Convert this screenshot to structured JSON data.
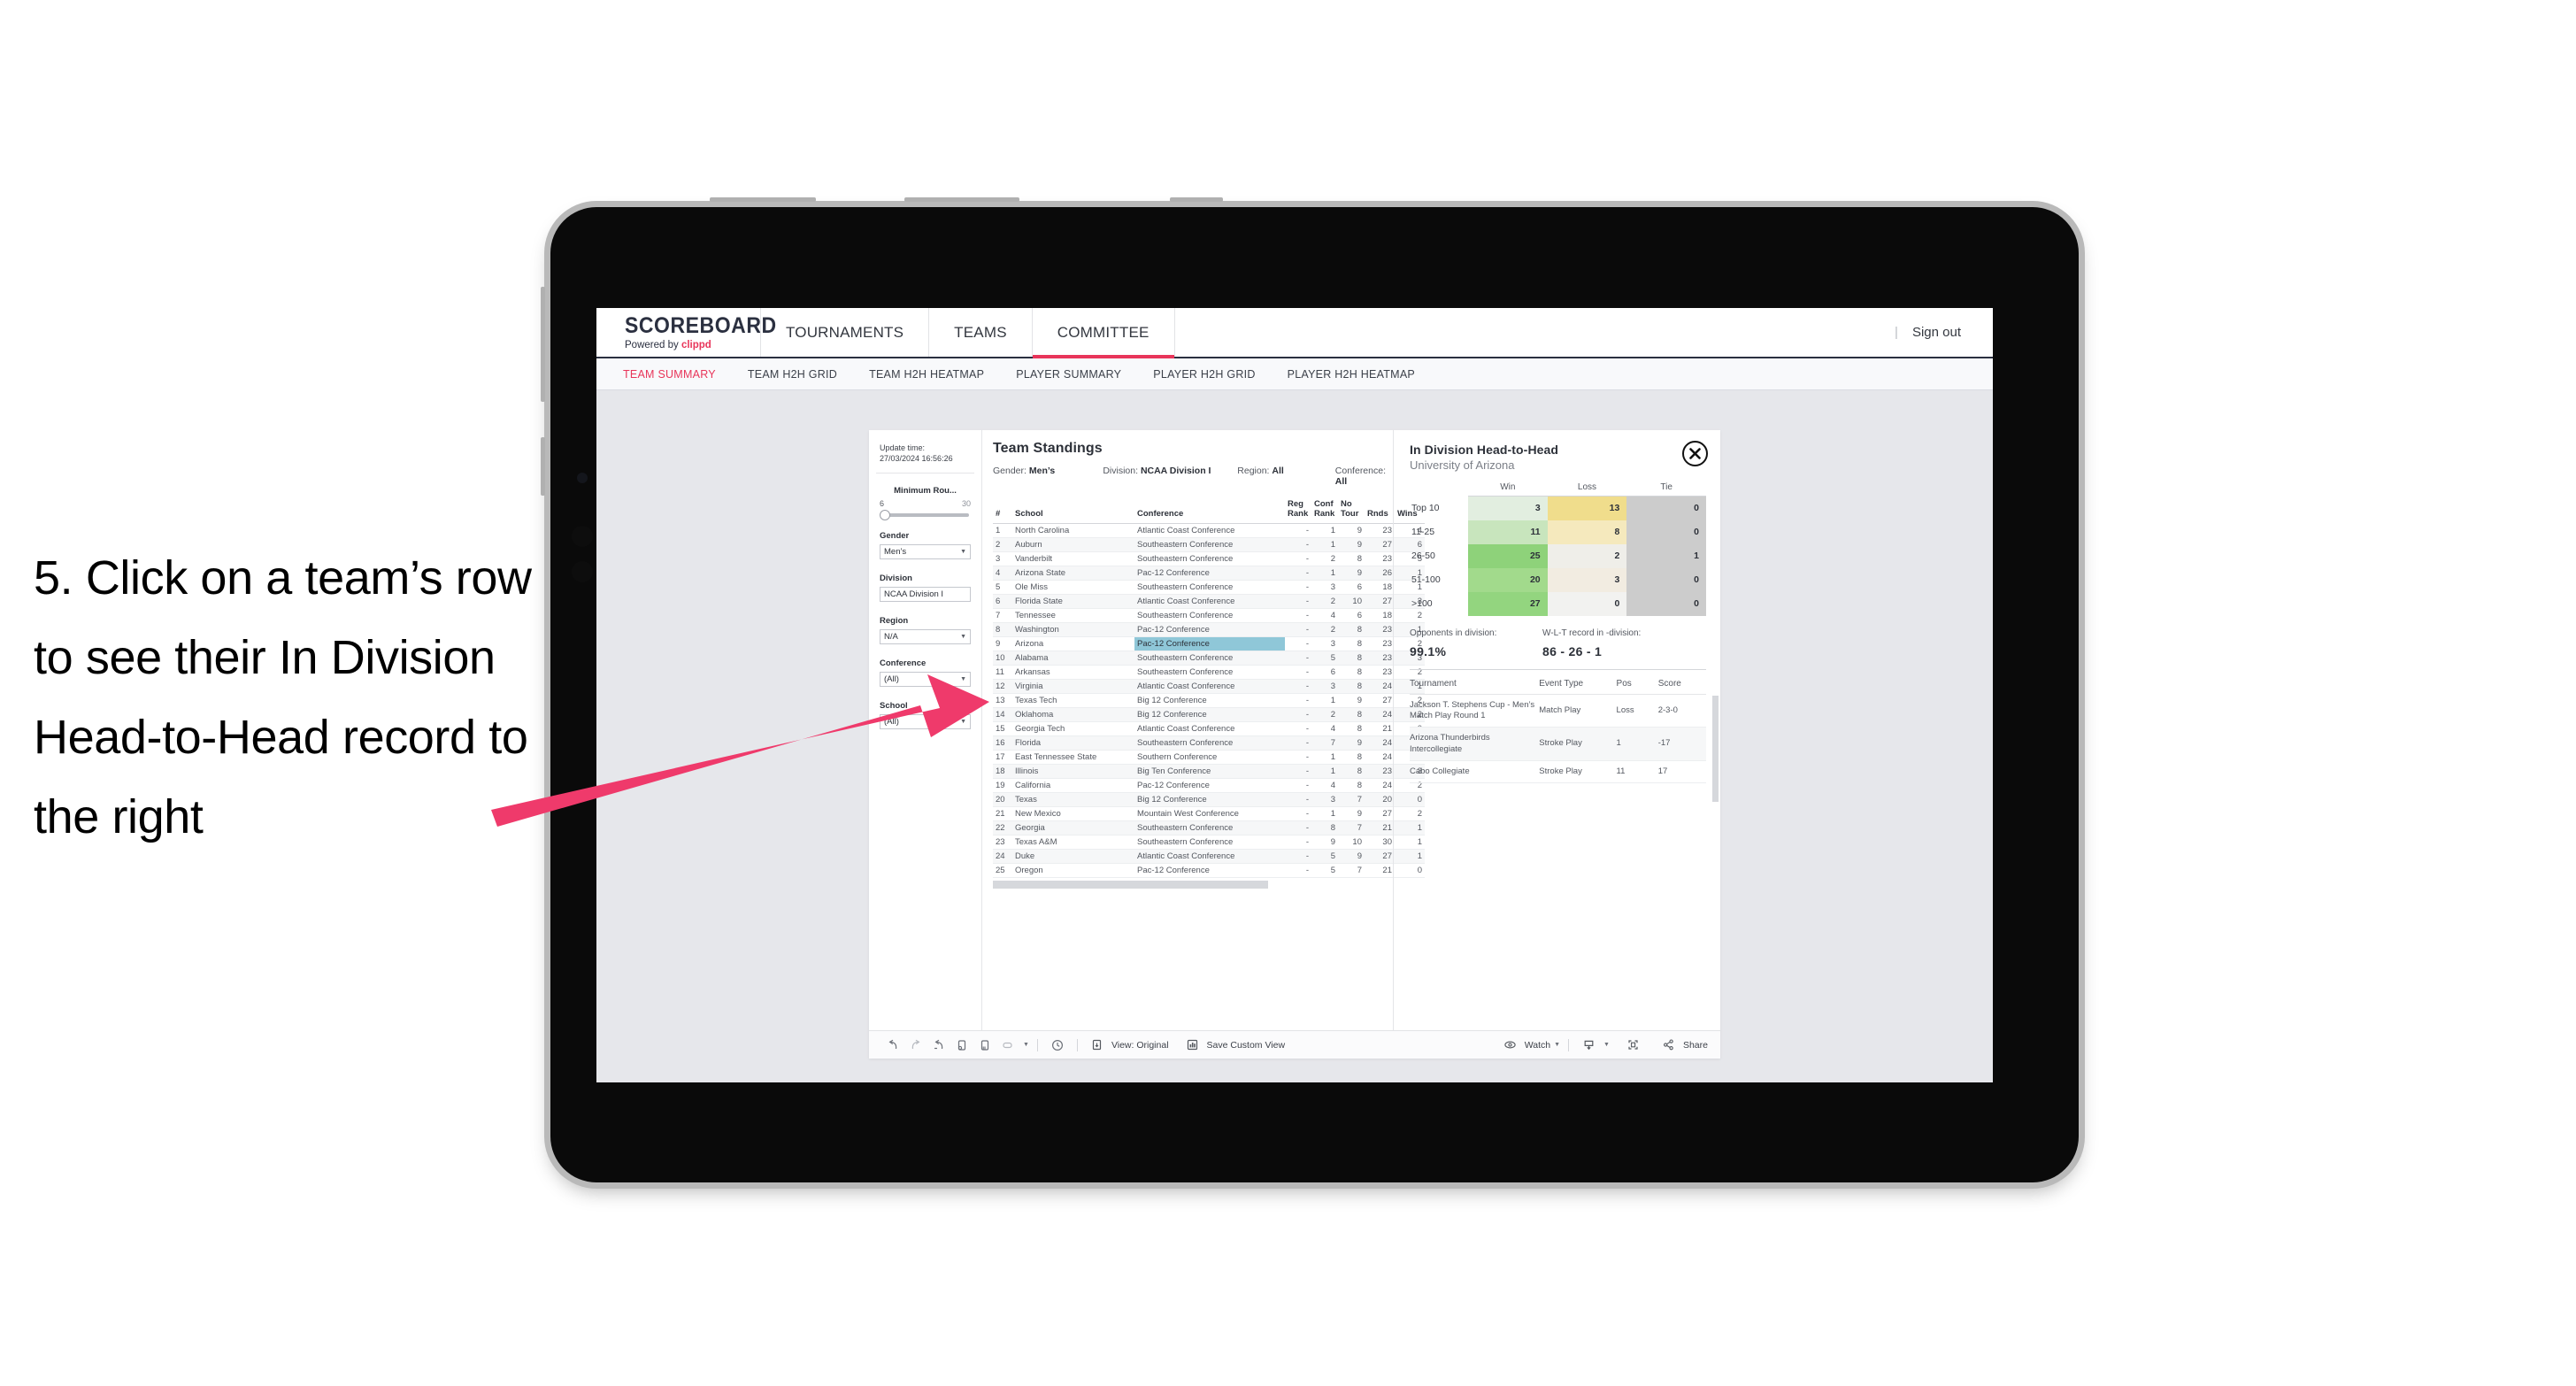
{
  "instruction": {
    "text": "5. Click on a team’s row to see their In Division Head-to-Head record to the right"
  },
  "colors": {
    "accent_pink": "#e8355a",
    "arrow_pink": "#ef3a6b",
    "navy": "#2b3040",
    "selected_cell": "#8fc7d8"
  },
  "app": {
    "logo": {
      "main": "SCOREBOARD",
      "powered_prefix": "Powered by ",
      "brand": "clippd"
    },
    "top_nav": [
      {
        "label": "TOURNAMENTS",
        "active": false
      },
      {
        "label": "TEAMS",
        "active": false
      },
      {
        "label": "COMMITTEE",
        "active": true
      }
    ],
    "account": {
      "divider": "|",
      "sign_out": "Sign out"
    },
    "sub_nav": [
      {
        "label": "TEAM SUMMARY",
        "active": true
      },
      {
        "label": "TEAM H2H GRID",
        "active": false
      },
      {
        "label": "TEAM H2H HEATMAP",
        "active": false
      },
      {
        "label": "PLAYER SUMMARY",
        "active": false
      },
      {
        "label": "PLAYER H2H GRID",
        "active": false
      },
      {
        "label": "PLAYER H2H HEATMAP",
        "active": false
      }
    ]
  },
  "filters": {
    "update_time_label": "Update time:",
    "update_time_value": "27/03/2024 16:56:26",
    "min_rounds": {
      "label": "Minimum Rou...",
      "min": "6",
      "max": "30"
    },
    "gender": {
      "label": "Gender",
      "value": "Men’s"
    },
    "division": {
      "label": "Division",
      "value": "NCAA Division I"
    },
    "region": {
      "label": "Region",
      "value": "N/A"
    },
    "conference": {
      "label": "Conference",
      "value": "(All)"
    },
    "school": {
      "label": "School",
      "value": "(All)"
    }
  },
  "standings": {
    "title": "Team Standings",
    "readout": {
      "gender_label": "Gender:",
      "gender_value": "Men’s",
      "division_label": "Division:",
      "division_value": "NCAA Division I",
      "region_label": "Region:",
      "region_value": "All",
      "conference_label": "Conference:",
      "conference_value": "All"
    },
    "columns": [
      "#",
      "School",
      "Conference",
      "Reg Rank",
      "Conf Rank",
      "No Tour",
      "Rnds",
      "Wins"
    ],
    "selected_row_index": 9,
    "rows": [
      {
        "rank": "1",
        "school": "North Carolina",
        "conference": "Atlantic Coast Conference",
        "reg_rank": "-",
        "conf_rank": "1",
        "no_tour": "9",
        "rnds": "23",
        "wins": "4"
      },
      {
        "rank": "2",
        "school": "Auburn",
        "conference": "Southeastern Conference",
        "reg_rank": "-",
        "conf_rank": "1",
        "no_tour": "9",
        "rnds": "27",
        "wins": "6"
      },
      {
        "rank": "3",
        "school": "Vanderbilt",
        "conference": "Southeastern Conference",
        "reg_rank": "-",
        "conf_rank": "2",
        "no_tour": "8",
        "rnds": "23",
        "wins": "5"
      },
      {
        "rank": "4",
        "school": "Arizona State",
        "conference": "Pac-12 Conference",
        "reg_rank": "-",
        "conf_rank": "1",
        "no_tour": "9",
        "rnds": "26",
        "wins": "1"
      },
      {
        "rank": "5",
        "school": "Ole Miss",
        "conference": "Southeastern Conference",
        "reg_rank": "-",
        "conf_rank": "3",
        "no_tour": "6",
        "rnds": "18",
        "wins": "1"
      },
      {
        "rank": "6",
        "school": "Florida State",
        "conference": "Atlantic Coast Conference",
        "reg_rank": "-",
        "conf_rank": "2",
        "no_tour": "10",
        "rnds": "27",
        "wins": "3"
      },
      {
        "rank": "7",
        "school": "Tennessee",
        "conference": "Southeastern Conference",
        "reg_rank": "-",
        "conf_rank": "4",
        "no_tour": "6",
        "rnds": "18",
        "wins": "2"
      },
      {
        "rank": "8",
        "school": "Washington",
        "conference": "Pac-12 Conference",
        "reg_rank": "-",
        "conf_rank": "2",
        "no_tour": "8",
        "rnds": "23",
        "wins": "1"
      },
      {
        "rank": "9",
        "school": "Arizona",
        "conference": "Pac-12 Conference",
        "reg_rank": "-",
        "conf_rank": "3",
        "no_tour": "8",
        "rnds": "23",
        "wins": "2"
      },
      {
        "rank": "10",
        "school": "Alabama",
        "conference": "Southeastern Conference",
        "reg_rank": "-",
        "conf_rank": "5",
        "no_tour": "8",
        "rnds": "23",
        "wins": "3"
      },
      {
        "rank": "11",
        "school": "Arkansas",
        "conference": "Southeastern Conference",
        "reg_rank": "-",
        "conf_rank": "6",
        "no_tour": "8",
        "rnds": "23",
        "wins": "2"
      },
      {
        "rank": "12",
        "school": "Virginia",
        "conference": "Atlantic Coast Conference",
        "reg_rank": "-",
        "conf_rank": "3",
        "no_tour": "8",
        "rnds": "24",
        "wins": "1"
      },
      {
        "rank": "13",
        "school": "Texas Tech",
        "conference": "Big 12 Conference",
        "reg_rank": "-",
        "conf_rank": "1",
        "no_tour": "9",
        "rnds": "27",
        "wins": "2"
      },
      {
        "rank": "14",
        "school": "Oklahoma",
        "conference": "Big 12 Conference",
        "reg_rank": "-",
        "conf_rank": "2",
        "no_tour": "8",
        "rnds": "24",
        "wins": "2"
      },
      {
        "rank": "15",
        "school": "Georgia Tech",
        "conference": "Atlantic Coast Conference",
        "reg_rank": "-",
        "conf_rank": "4",
        "no_tour": "8",
        "rnds": "21",
        "wins": "0"
      },
      {
        "rank": "16",
        "school": "Florida",
        "conference": "Southeastern Conference",
        "reg_rank": "-",
        "conf_rank": "7",
        "no_tour": "9",
        "rnds": "24",
        "wins": "4"
      },
      {
        "rank": "17",
        "school": "East Tennessee State",
        "conference": "Southern Conference",
        "reg_rank": "-",
        "conf_rank": "1",
        "no_tour": "8",
        "rnds": "24",
        "wins": "2"
      },
      {
        "rank": "18",
        "school": "Illinois",
        "conference": "Big Ten Conference",
        "reg_rank": "-",
        "conf_rank": "1",
        "no_tour": "8",
        "rnds": "23",
        "wins": "3"
      },
      {
        "rank": "19",
        "school": "California",
        "conference": "Pac-12 Conference",
        "reg_rank": "-",
        "conf_rank": "4",
        "no_tour": "8",
        "rnds": "24",
        "wins": "2"
      },
      {
        "rank": "20",
        "school": "Texas",
        "conference": "Big 12 Conference",
        "reg_rank": "-",
        "conf_rank": "3",
        "no_tour": "7",
        "rnds": "20",
        "wins": "0"
      },
      {
        "rank": "21",
        "school": "New Mexico",
        "conference": "Mountain West Conference",
        "reg_rank": "-",
        "conf_rank": "1",
        "no_tour": "9",
        "rnds": "27",
        "wins": "2"
      },
      {
        "rank": "22",
        "school": "Georgia",
        "conference": "Southeastern Conference",
        "reg_rank": "-",
        "conf_rank": "8",
        "no_tour": "7",
        "rnds": "21",
        "wins": "1"
      },
      {
        "rank": "23",
        "school": "Texas A&M",
        "conference": "Southeastern Conference",
        "reg_rank": "-",
        "conf_rank": "9",
        "no_tour": "10",
        "rnds": "30",
        "wins": "1"
      },
      {
        "rank": "24",
        "school": "Duke",
        "conference": "Atlantic Coast Conference",
        "reg_rank": "-",
        "conf_rank": "5",
        "no_tour": "9",
        "rnds": "27",
        "wins": "1"
      },
      {
        "rank": "25",
        "school": "Oregon",
        "conference": "Pac-12 Conference",
        "reg_rank": "-",
        "conf_rank": "5",
        "no_tour": "7",
        "rnds": "21",
        "wins": "0"
      }
    ]
  },
  "detail": {
    "title": "In Division Head-to-Head",
    "subtitle": "University of Arizona",
    "close_icon": "close-x-icon",
    "chart_data": {
      "type": "heatmap",
      "title": "In Division Head-to-Head",
      "subtitle": "University of Arizona",
      "columns": [
        "Win",
        "Loss",
        "Tie"
      ],
      "rows": [
        "Top 10",
        "11-25",
        "26-50",
        "51-100",
        ">100"
      ],
      "values": [
        [
          3,
          13,
          0
        ],
        [
          11,
          8,
          0
        ],
        [
          25,
          2,
          1
        ],
        [
          20,
          3,
          0
        ],
        [
          27,
          0,
          0
        ]
      ],
      "cell_colors": [
        [
          "#e2eee0",
          "#f0dd8c",
          "#cccccc"
        ],
        [
          "#c8e5bd",
          "#f5e9bd",
          "#cccccc"
        ],
        [
          "#8ed27a",
          "#efeee9",
          "#cccccc"
        ],
        [
          "#a2da8c",
          "#f2ece1",
          "#cccccc"
        ],
        [
          "#93d57f",
          "#f2f2f0",
          "#cccccc"
        ]
      ]
    },
    "stats": [
      {
        "label": "Opponents in division:",
        "value": "99.1%"
      },
      {
        "label": "W-L-T record in -division:",
        "value": "86 - 26 - 1"
      }
    ],
    "tournaments": {
      "columns": [
        "Tournament",
        "Event Type",
        "Pos",
        "Score"
      ],
      "rows": [
        {
          "name": "Jackson T. Stephens Cup - Men’s Match Play Round 1",
          "event_type": "Match Play",
          "pos": "Loss",
          "score": "2-3-0"
        },
        {
          "name": "Arizona Thunderbirds Intercollegiate",
          "event_type": "Stroke Play",
          "pos": "1",
          "score": "-17"
        },
        {
          "name": "Cabo Collegiate",
          "event_type": "Stroke Play",
          "pos": "11",
          "score": "17"
        }
      ]
    }
  },
  "toolbar": {
    "undo": "undo-icon",
    "redo": "redo-icon",
    "revert": "revert-icon",
    "refresh": "refresh-data-icon",
    "pause": "pause-updates-icon",
    "highlight": "highlight-icon",
    "alert": "alert-icon",
    "view_label": "View: Original",
    "save_label": "Save Custom View",
    "watch_label": "Watch",
    "download_icon": "download-icon",
    "fullscreen_icon": "fullscreen-icon",
    "share_label": "Share"
  }
}
